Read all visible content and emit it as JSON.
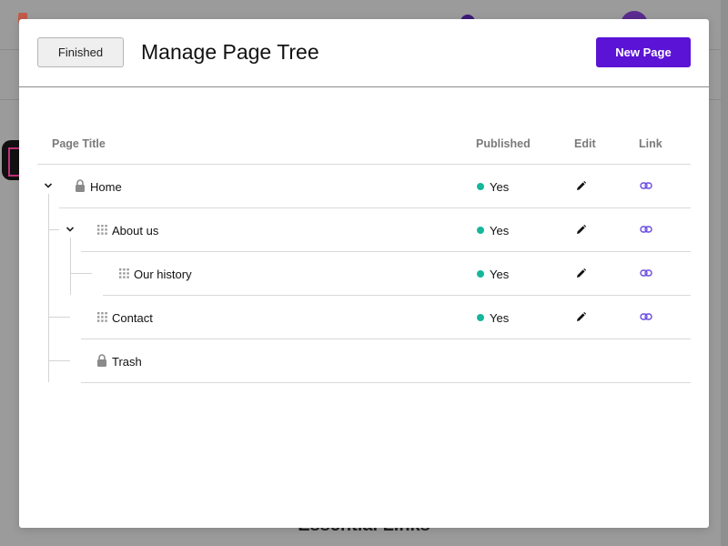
{
  "background": {
    "heading": "Essential Links"
  },
  "modal": {
    "finished_label": "Finished",
    "title": "Manage Page Tree",
    "new_page_label": "New Page"
  },
  "table": {
    "columns": {
      "title": "Page Title",
      "published": "Published",
      "edit": "Edit",
      "link": "Link"
    },
    "rows": [
      {
        "title": "Home",
        "published": "Yes",
        "locked": true,
        "expanded": true,
        "depth": 0
      },
      {
        "title": "About us",
        "published": "Yes",
        "locked": false,
        "expanded": true,
        "depth": 1
      },
      {
        "title": "Our history",
        "published": "Yes",
        "locked": false,
        "depth": 2
      },
      {
        "title": "Contact",
        "published": "Yes",
        "locked": false,
        "depth": 1
      },
      {
        "title": "Trash",
        "locked": true,
        "depth": 1
      }
    ]
  },
  "colors": {
    "accent": "#5b13d6",
    "published_dot": "#16b69a",
    "link_icon": "#6a4ce0"
  },
  "icons": {
    "lock": "lock-icon",
    "drag": "drag-handle-icon",
    "edit": "pencil-icon",
    "link": "link-icon",
    "expand": "chevron-down-icon"
  }
}
